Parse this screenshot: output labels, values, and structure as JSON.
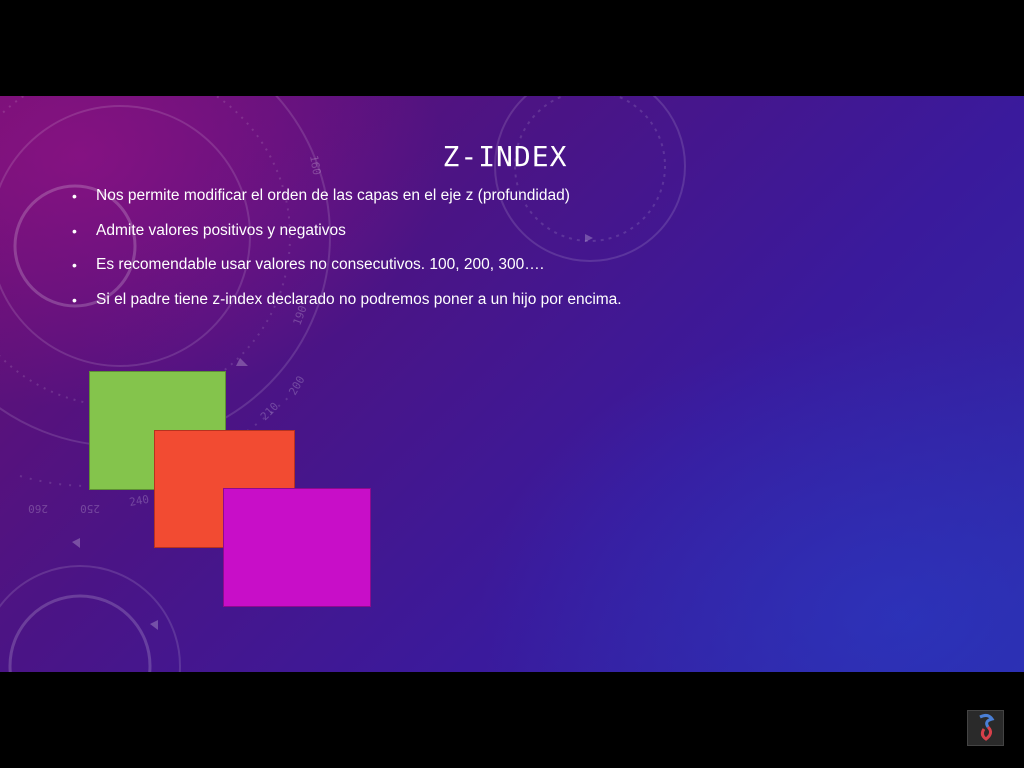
{
  "slide": {
    "title": "Z-INDEX",
    "bullets": [
      "Nos permite modificar el orden de las capas en el eje z (profundidad)",
      "Admite valores positivos y negativos",
      "Es recomendable usar valores no consecutivos. 100, 200, 300….",
      "Si el padre tiene z-index declarado no podremos poner a un hijo por encima."
    ],
    "bullet_glyph": "•",
    "layers": [
      {
        "name": "green",
        "color": "#84c44c"
      },
      {
        "name": "red",
        "color": "#f24b32"
      },
      {
        "name": "magenta",
        "color": "#c80ec8"
      }
    ],
    "dial_numbers": [
      "190",
      "200",
      "210",
      "220",
      "240",
      "250",
      "260",
      "160"
    ]
  },
  "theme": {
    "background_start": "#6a0f70",
    "background_end": "#2e2aa8",
    "letterbox": "#000000",
    "text_color": "#ffffff"
  },
  "player": {
    "logo_icon": "player-logo-icon"
  }
}
